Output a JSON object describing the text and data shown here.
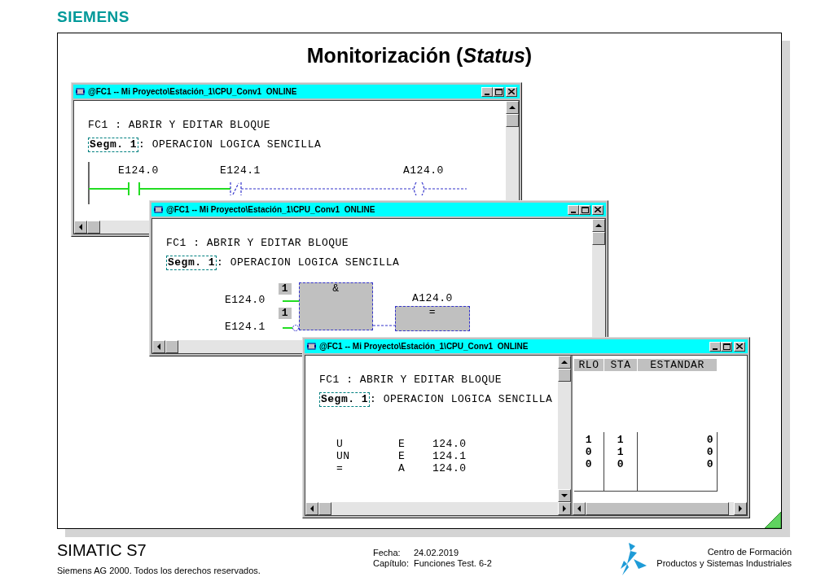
{
  "brand": "SIEMENS",
  "title": "Monitorización (*Status*)",
  "windows": [
    {
      "kind": "ladder",
      "title": "@FC1 -- Mi Proyecto\\Estación_1\\CPU_Conv1  ONLINE",
      "block_line": "FC1 : ABRIR Y EDITAR BLOQUE",
      "segment_label": "Segm. 1",
      "segment_title": ": OPERACION LOGICA SENCILLA",
      "elements": [
        {
          "kind": "contact",
          "label": "E124.0",
          "active": true
        },
        {
          "kind": "contact_nc",
          "label": "E124.1",
          "active": false
        },
        {
          "kind": "coil",
          "label": "A124.0",
          "active": false
        }
      ]
    },
    {
      "kind": "fbd",
      "title": "@FC1 -- Mi Proyecto\\Estación_1\\CPU_Conv1  ONLINE",
      "block_line": "FC1 : ABRIR Y EDITAR BLOQUE",
      "segment_label": "Segm. 1",
      "segment_title": ": OPERACION LOGICA SENCILLA",
      "inputs": [
        {
          "label": "E124.0",
          "value": "1",
          "negated": false,
          "active": true
        },
        {
          "label": "E124.1",
          "value": "1",
          "negated": true,
          "active": true
        }
      ],
      "gate": "&",
      "output": {
        "label": "A124.0",
        "gate": "=",
        "active": false
      }
    },
    {
      "kind": "stl",
      "title": "@FC1 -- Mi Proyecto\\Estación_1\\CPU_Conv1  ONLINE",
      "block_line": "FC1 : ABRIR Y EDITAR BLOQUE",
      "segment_label": "Segm. 1",
      "segment_title": ": OPERACION LOGICA SENCILLA",
      "columns": [
        "RLO",
        "STA",
        "ESTANDAR"
      ],
      "rows": [
        {
          "op": "U",
          "operand": "E",
          "address": "124.0",
          "values": [
            "1",
            "1",
            "0"
          ]
        },
        {
          "op": "UN",
          "operand": "E",
          "address": "124.1",
          "values": [
            "0",
            "1",
            "0"
          ]
        },
        {
          "op": "=",
          "operand": "A",
          "address": "124.0",
          "values": [
            "0",
            "0",
            "0"
          ]
        }
      ]
    }
  ],
  "footer": {
    "product": "SIMATIC S7",
    "copyright": "Siemens AG 2000. Todos los derechos reservados.",
    "fields": [
      {
        "label": "Fecha:",
        "value": "24.02.2019"
      },
      {
        "label": "Capítulo:",
        "value": "Funciones Test. 6-2"
      }
    ],
    "center": [
      "Centro de Formación",
      "Productos y Sistemas Industriales"
    ]
  }
}
